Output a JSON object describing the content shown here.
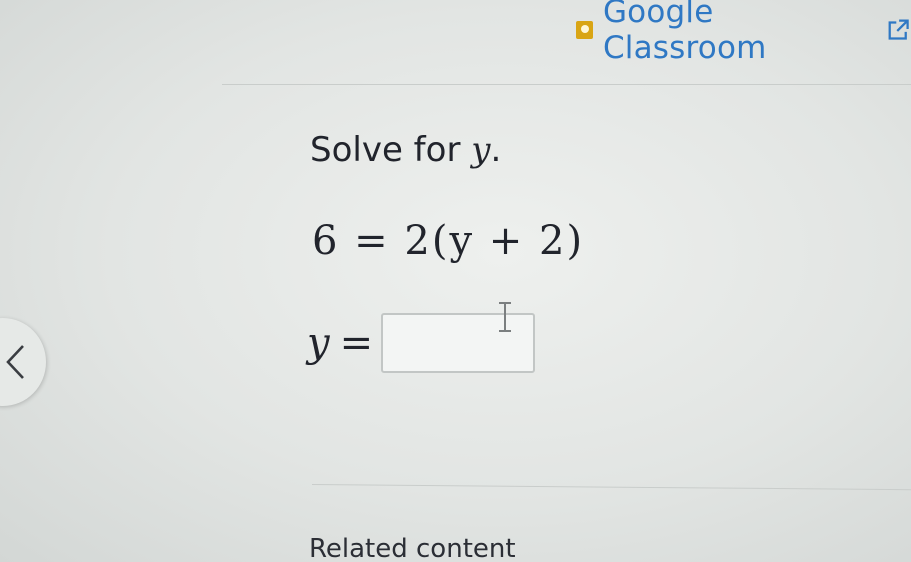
{
  "header": {
    "classroom_link_label": "Google Classroom",
    "icons": [
      "google-classroom-logo",
      "external-link-icon"
    ]
  },
  "question": {
    "prompt_text": "Solve for ",
    "prompt_variable": "y",
    "prompt_period": ".",
    "equation": "6 = 2(y + 2)",
    "answer_variable": "y",
    "answer_equals": "=",
    "answer_value": ""
  },
  "navigation": {
    "back_icon": "chevron-left-icon"
  },
  "footer": {
    "related_heading": "Related content"
  },
  "colors": {
    "link": "#2f78c4",
    "classroom_logo": "#d9a514",
    "text": "#21242c",
    "input_border": "#c2c6c5"
  }
}
